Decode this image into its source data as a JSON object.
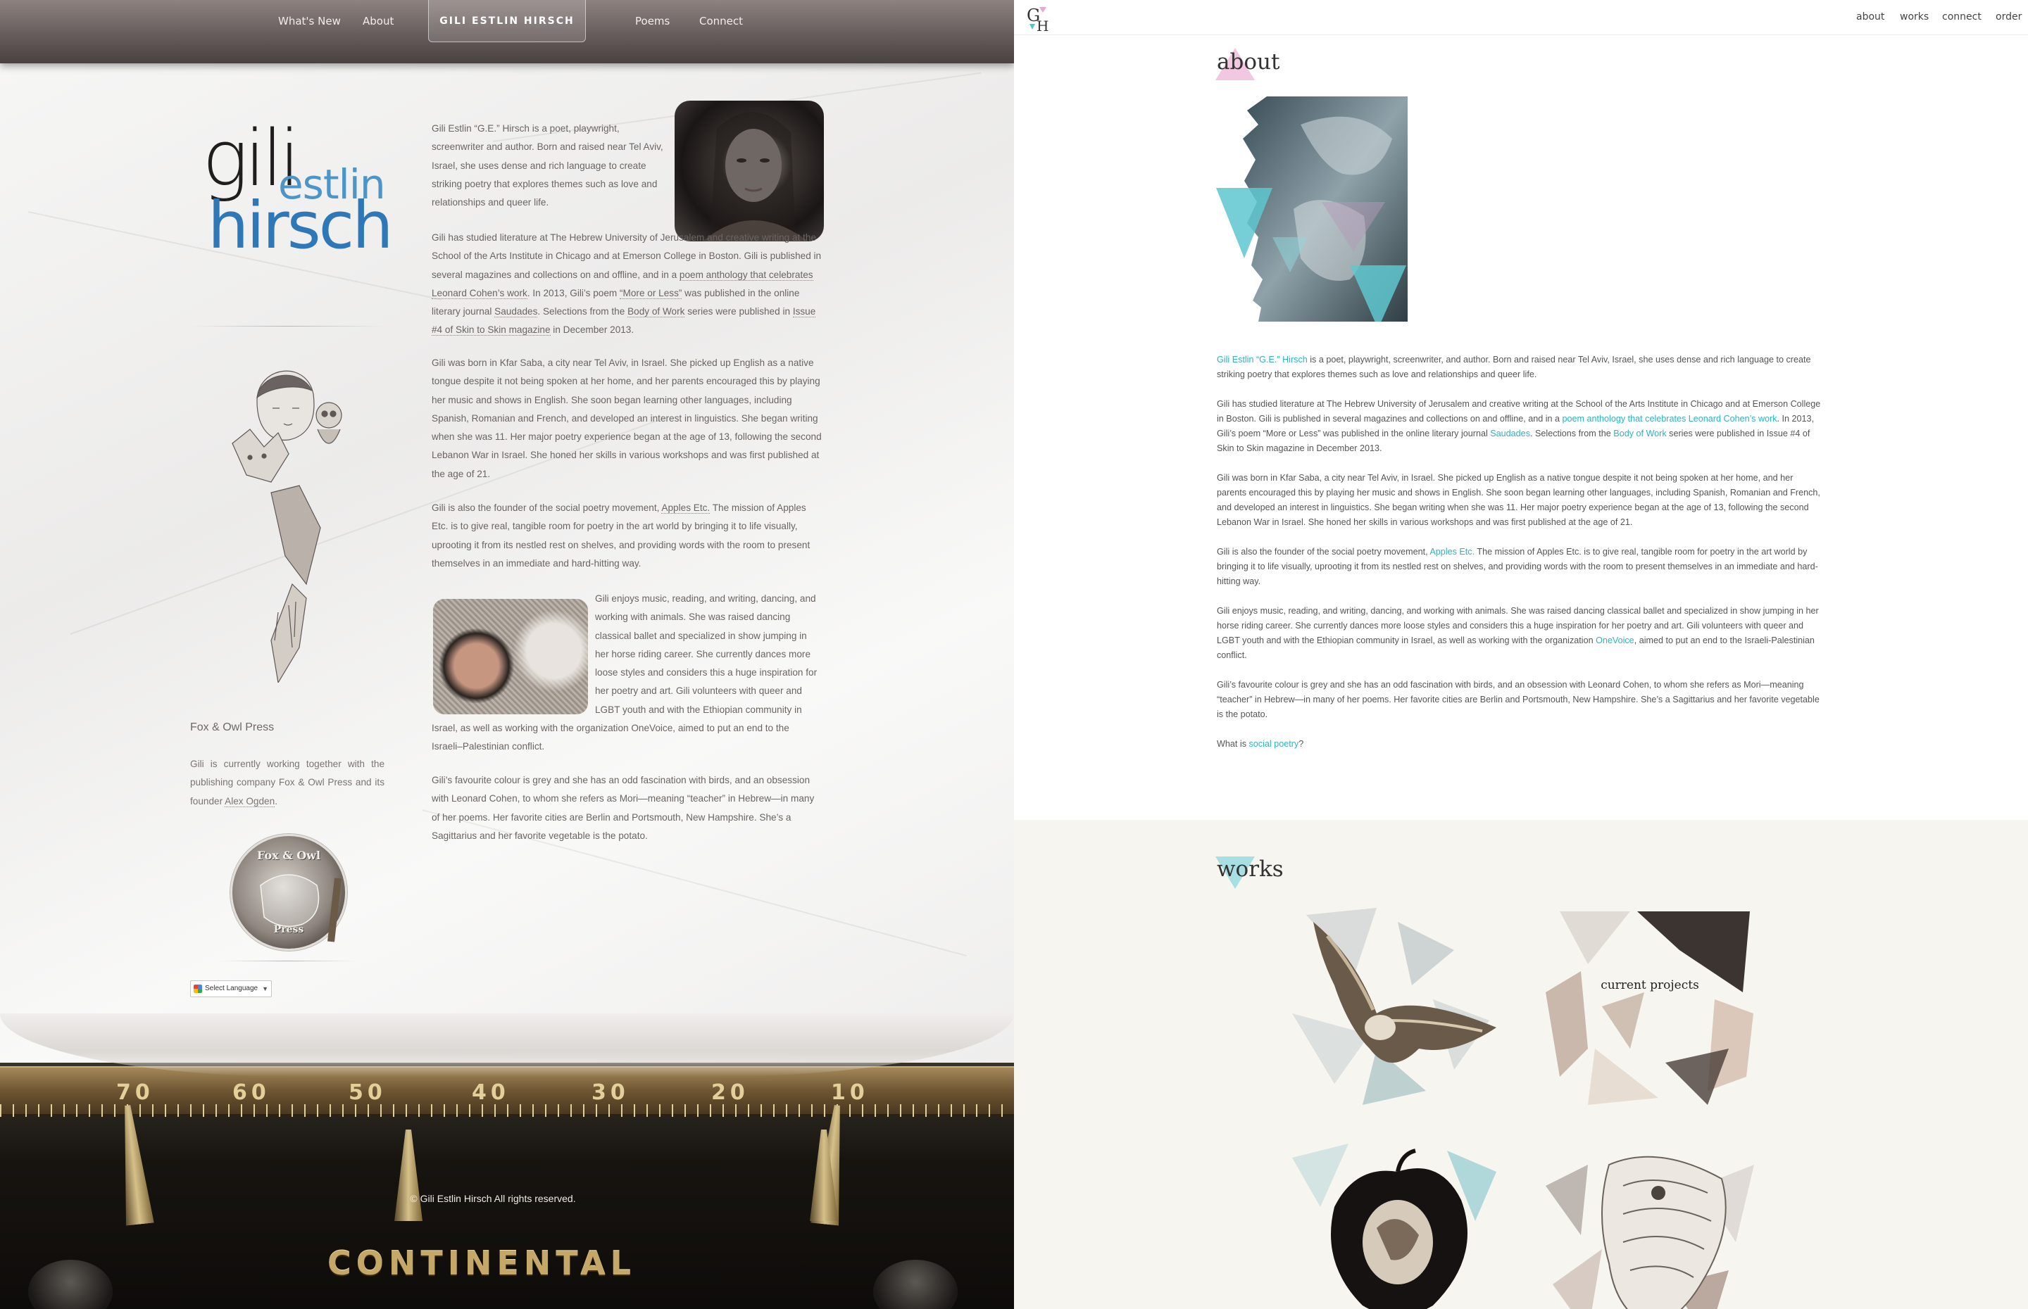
{
  "left": {
    "nav": {
      "whats_new": "What's New",
      "about": "About",
      "brand": "GILI ESTLIN HIRSCH",
      "poems": "Poems",
      "connect": "Connect"
    },
    "logo": {
      "line1": "gili",
      "line2": "estlin",
      "line3": "hirsch"
    },
    "bio": {
      "p1": "Gili Estlin “G.E.” Hirsch is a poet, playwright, screenwriter and author. Born and raised near Tel Aviv, Israel, she uses dense and rich language to create striking poetry that explores themes such as love and relationships and queer life.",
      "p2_a": "Gili has studied literature at The Hebrew University of Jerusalem and creative writing at the School of the Arts Institute in Chicago and at Emerson College in Boston. Gili is published in several magazines and collections on and offline, and in a ",
      "p2_link1": "poem anthology that celebrates Leonard Cohen’s work",
      "p2_b": ". In 2013, Gili’s poem ",
      "p2_link2": "“More or Less”",
      "p2_c": " was published in the online literary journal ",
      "p2_link3": "Saudades",
      "p2_d": ". Selections from the ",
      "p2_link4": "Body of Work",
      "p2_e": " series were published in ",
      "p2_link5": "Issue #4 of Skin to Skin magazine",
      "p2_f": " in December 2013.",
      "p3": "Gili was born in Kfar Saba, a city near Tel Aviv, in Israel. She picked up English as a native tongue despite it not being spoken at her home, and her parents encouraged this by playing her music and shows in English. She soon began learning other languages, including Spanish, Romanian and French, and developed an interest in linguistics. She began writing when she was 11. Her major poetry experience began at the age of 13, following the second Lebanon War in Israel. She honed her skills in various workshops and was first published at the age of 21.",
      "p4_a": "Gili is also the founder of the social poetry movement, ",
      "p4_link": "Apples Etc.",
      "p4_b": " The mission of Apples Etc. is to give real, tangible room for poetry in the art world by bringing it to life visually, uprooting it from its nestled rest on shelves, and providing words with the room to present themselves in an immediate and hard-hitting way.",
      "p5": "Gili enjoys music, reading, and writing, dancing, and working with animals. She was raised dancing classical ballet and specialized in show jumping in her horse riding career. She currently dances more loose styles and considers this a huge inspiration for her poetry and art. Gili volunteers with queer and LGBT youth and with the Ethiopian community in Israel, as well as working with the organization OneVoice, aimed to put an end to the Israeli–Palestinian conflict.",
      "p6": "Gili’s favourite colour is grey and she has an odd fascination with birds, and an obsession with Leonard Cohen, to whom she refers as Mori—meaning “teacher” in Hebrew—in many of her poems. Her favorite cities are Berlin and Portsmouth, New Hampshire. She’s a Sagittarius and her favorite vegetable is the potato."
    },
    "sidebar": {
      "fox_title": "Fox & Owl Press",
      "fox_text_a": "Gili is currently working together with the publishing company Fox & Owl Press and its founder ",
      "fox_link": "Alex Ogden",
      "fox_text_b": ".",
      "badge_top": "Fox & Owl",
      "badge_bottom": "Press",
      "translate": "Select Language",
      "translate_arrow": "▼"
    },
    "typewriter": {
      "ruler": [
        "70",
        "60",
        "50",
        "40",
        "30",
        "20",
        "10"
      ],
      "brand": "CONTINENTAL"
    },
    "copyright": "© Gili Estlin Hirsch All rights reserved."
  },
  "right": {
    "logo": "GH",
    "nav": {
      "about": "about",
      "works": "works",
      "connect": "connect",
      "order": "order"
    },
    "about_title": "about",
    "bio": {
      "p1_link": "Gili Estlin “G.E.” Hirsch",
      "p1": " is a poet, playwright, screenwriter, and author. Born and raised near Tel Aviv, Israel, she uses dense and rich language to create striking poetry that explores themes such as love and relationships and queer life.",
      "p2_a": "Gili has studied literature at The Hebrew University of Jerusalem and creative writing at the School of the Arts Institute in Chicago and at Emerson College in Boston. Gili is published in several magazines and collections on and offline, and in a ",
      "p2_link1": "poem anthology that celebrates Leonard Cohen’s work",
      "p2_b": ". In 2013, Gili’s poem “More or Less” was published in the online literary journal ",
      "p2_link2": "Saudades",
      "p2_c": ". Selections from the ",
      "p2_link3": "Body of Work",
      "p2_d": " series were published in Issue #4 of Skin to Skin magazine in December 2013.",
      "p3": "Gili was born in Kfar Saba, a city near Tel Aviv, in Israel. She picked up English as a native tongue despite it not being spoken at her home, and her parents encouraged this by playing her music and shows in English. She soon began learning other languages, including Spanish, Romanian and French, and developed an interest in linguistics. She began writing when she was 11. Her major poetry experience began at the age of 13, following the second Lebanon War in Israel. She honed her skills in various workshops and was first published at the age of 21.",
      "p4_a": "Gili is also the founder of the social poetry movement, ",
      "p4_link": "Apples Etc.",
      "p4_b": " The mission of Apples Etc. is to give real, tangible room for poetry in the art world by bringing it to life visually, uprooting it from its nestled rest on shelves, and providing words with the room to present themselves in an immediate and hard-hitting way.",
      "p5_a": "Gili enjoys music, reading, and writing, dancing, and working with animals. She was raised dancing classical ballet and specialized in show jumping in her horse riding career. She currently dances more loose styles and considers this a huge inspiration for her poetry and art. Gili volunteers with queer and LGBT youth and with the Ethiopian community in Israel, as well as working with the organization ",
      "p5_link": "OneVoice",
      "p5_b": ", aimed to put an end to the Israeli-Palestinian conflict.",
      "p6": "Gili’s favourite colour is grey and she has an odd fascination with birds, and an obsession with Leonard Cohen, to whom she refers as Mori—meaning “teacher” in Hebrew—in many of her poems. Her favorite cities are Berlin and Portsmouth, New Hampshire. She’s a Sagittarius and her favorite vegetable is the potato.",
      "p7_a": "What is ",
      "p7_link": "social poetry",
      "p7_b": "?"
    },
    "works_title": "works",
    "current_projects": "current projects"
  },
  "colors": {
    "teal": "#2cb3c0",
    "pink": "#e7a9cf",
    "logo_blue": "#2e78b8"
  }
}
